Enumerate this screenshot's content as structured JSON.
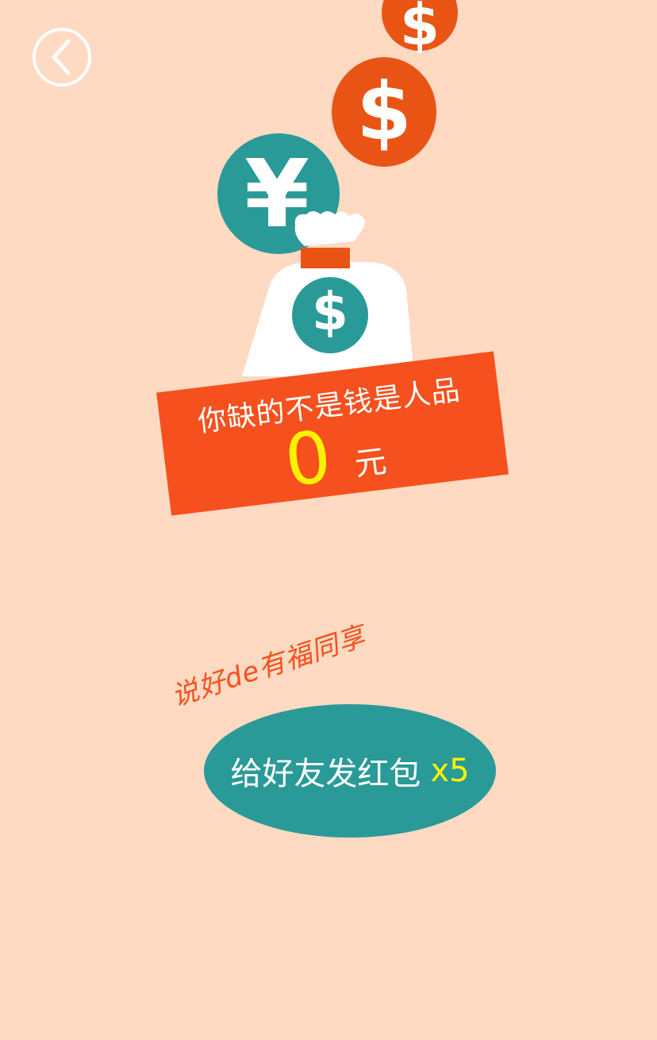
{
  "nav": {
    "back_icon": "chevron-left-circle-icon"
  },
  "coins": [
    {
      "symbol": "$",
      "color": "#E95414"
    },
    {
      "symbol": "$",
      "color": "#E95414"
    },
    {
      "symbol": "¥",
      "color": "#2A9A98"
    }
  ],
  "bag": {
    "symbol": "$",
    "bag_color": "#FFFFFF",
    "tie_color": "#E95414",
    "badge_color": "#2A9A98"
  },
  "result": {
    "headline": "你缺的不是钱是人品",
    "amount": "0",
    "unit": "元"
  },
  "share": {
    "tagline": "说好de有福同享",
    "button_label": "给好友发红包",
    "count": "x5"
  },
  "colors": {
    "background": "#FEDAC2",
    "orange": "#F5501D",
    "teal": "#2A9A98",
    "highlight": "#FFF200"
  }
}
